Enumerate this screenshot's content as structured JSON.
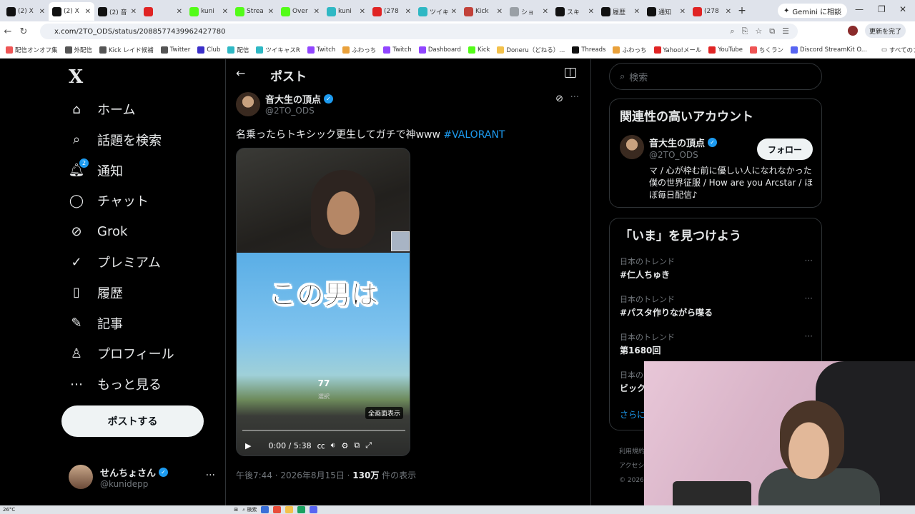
{
  "browser": {
    "tabs": [
      {
        "label": "(2) X",
        "color": "#111"
      },
      {
        "label": "(2) X",
        "color": "#111",
        "active": true
      },
      {
        "label": "(2) 音",
        "color": "#111"
      },
      {
        "label": "",
        "color": "#e02424"
      },
      {
        "label": "kuni",
        "color": "#53fc18"
      },
      {
        "label": "Strea",
        "color": "#53fc18"
      },
      {
        "label": "Over",
        "color": "#53fc18"
      },
      {
        "label": "kuni",
        "color": "#2fb8c4"
      },
      {
        "label": "(278",
        "color": "#e02424"
      },
      {
        "label": "ツイキ",
        "color": "#2fb8c4"
      },
      {
        "label": "Kick",
        "color": "#c2423a"
      },
      {
        "label": "ショ",
        "color": "#9aa0a6"
      },
      {
        "label": "スキ",
        "color": "#111"
      },
      {
        "label": "履歴",
        "color": "#111"
      },
      {
        "label": "通知",
        "color": "#111"
      },
      {
        "label": "(278",
        "color": "#e02424"
      }
    ],
    "new_tab": "+",
    "gemini_label": "Gemini に相談",
    "url": "x.com/2TO_ODS/status/2088577439962427780",
    "update_label": "更新を完了",
    "bookmarks": [
      {
        "label": "配信オンオフ集",
        "color": "#e55"
      },
      {
        "label": "外配信",
        "color": "#555"
      },
      {
        "label": "Kick レイド候補",
        "color": "#555"
      },
      {
        "label": "Twitter",
        "color": "#555"
      },
      {
        "label": "Club",
        "color": "#3b2fc9"
      },
      {
        "label": "配信",
        "color": "#2fb8c4"
      },
      {
        "label": "ツイキャスR",
        "color": "#2fb8c4"
      },
      {
        "label": "Twitch",
        "color": "#9146ff"
      },
      {
        "label": "ふわっち",
        "color": "#e9a13b"
      },
      {
        "label": "Twitch",
        "color": "#9146ff"
      },
      {
        "label": "Dashboard",
        "color": "#9146ff"
      },
      {
        "label": "Kick",
        "color": "#53fc18"
      },
      {
        "label": "Doneru（どねる）...",
        "color": "#f3c14b"
      },
      {
        "label": "Threads",
        "color": "#111"
      },
      {
        "label": "ふわっち",
        "color": "#e9a13b"
      },
      {
        "label": "Yahoo!メール",
        "color": "#e02424"
      },
      {
        "label": "YouTube",
        "color": "#e02424"
      },
      {
        "label": "ちくラン",
        "color": "#e55"
      },
      {
        "label": "Discord StreamKit O...",
        "color": "#5865f2"
      }
    ],
    "all_bookmarks": "すべてのブックマーク"
  },
  "leftnav": {
    "logo": "X",
    "items": [
      {
        "label": "ホーム",
        "icon": "home-icon",
        "glyph": "⌂"
      },
      {
        "label": "話題を検索",
        "icon": "search-icon",
        "glyph": "⌕"
      },
      {
        "label": "通知",
        "icon": "bell-icon",
        "glyph": "🔔︎",
        "badge": "2"
      },
      {
        "label": "チャット",
        "icon": "chat-icon",
        "glyph": "◯"
      },
      {
        "label": "Grok",
        "icon": "grok-icon",
        "glyph": "⊘"
      },
      {
        "label": "プレミアム",
        "icon": "premium-icon",
        "glyph": "✓"
      },
      {
        "label": "履歴",
        "icon": "bookmark-icon",
        "glyph": "▯"
      },
      {
        "label": "記事",
        "icon": "article-icon",
        "glyph": "✎"
      },
      {
        "label": "プロフィール",
        "icon": "profile-icon",
        "glyph": "♙"
      },
      {
        "label": "もっと見る",
        "icon": "more-icon",
        "glyph": "⋯"
      }
    ],
    "post_button": "ポストする",
    "account": {
      "name": "せんちょさん",
      "handle": "@kunidepp",
      "more": "···"
    }
  },
  "main": {
    "header_title": "ポスト",
    "back": "←",
    "author": {
      "name": "音大生の頂点",
      "handle": "@2TO_ODS"
    },
    "text": "名乗ったらトキシック更生してガチで神www ",
    "hashtag": "#VALORANT",
    "video": {
      "caption": "この男は",
      "overlay_number": "77",
      "overlay_sub": "選択",
      "tooltip": "全画面表示",
      "time": "0:00 / 5:38",
      "progress": 0
    },
    "meta": {
      "time": "午後7:44 · 2026年8月15日 · ",
      "views": "130万",
      "views_suffix": " 件の表示"
    }
  },
  "right": {
    "search_placeholder": "検索",
    "related": {
      "title": "関連性の高いアカウント",
      "name": "音大生の頂点",
      "handle": "@2TO_ODS",
      "follow": "フォロー",
      "bio": "マ / 心が枠む前に優しい人になれなかった僕の世界征服 / How are you Arcstar / ほぼ毎日配信♪"
    },
    "trends": {
      "title": "「いま」を見つけよう",
      "items": [
        {
          "category": "日本のトレンド",
          "name": "#仁人ちゅき"
        },
        {
          "category": "日本のトレンド",
          "name": "#パスタ作りながら喋る"
        },
        {
          "category": "日本のトレンド",
          "name": "第1680回"
        },
        {
          "category": "日本の",
          "name": "ビック"
        }
      ],
      "show_more": "さらに"
    },
    "footer": [
      "利用規約",
      "アクセシ",
      "© 2026"
    ]
  },
  "taskbar": {
    "weather": "26°C",
    "search": "検索"
  }
}
